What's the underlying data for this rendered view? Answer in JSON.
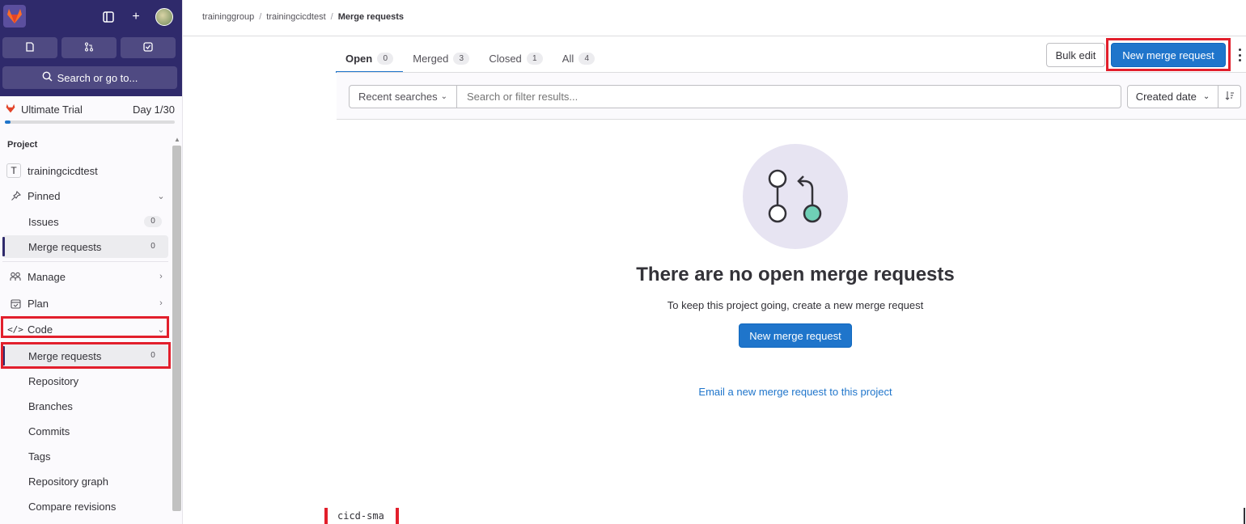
{
  "sidebar": {
    "search_label": "Search or go to...",
    "trial": {
      "label": "Ultimate Trial",
      "day": "Day 1/30",
      "progress": 0.033
    },
    "section_title": "Project",
    "project_name": "trainingcicdtest",
    "project_initial": "T",
    "pinned_label": "Pinned",
    "pinned_items": [
      {
        "label": "Issues",
        "count": "0"
      },
      {
        "label": "Merge requests",
        "count": "0"
      }
    ],
    "groups": [
      {
        "label": "Manage"
      },
      {
        "label": "Plan"
      },
      {
        "label": "Code"
      }
    ],
    "code_items": [
      {
        "label": "Merge requests",
        "count": "0"
      },
      {
        "label": "Repository"
      },
      {
        "label": "Branches"
      },
      {
        "label": "Commits"
      },
      {
        "label": "Tags"
      },
      {
        "label": "Repository graph"
      },
      {
        "label": "Compare revisions"
      }
    ]
  },
  "breadcrumb": [
    "traininggroup",
    "trainingcicdtest",
    "Merge requests"
  ],
  "tabs": [
    {
      "label": "Open",
      "count": "0"
    },
    {
      "label": "Merged",
      "count": "3"
    },
    {
      "label": "Closed",
      "count": "1"
    },
    {
      "label": "All",
      "count": "4"
    }
  ],
  "actions": {
    "bulk_edit": "Bulk edit",
    "new_mr": "New merge request"
  },
  "filter": {
    "recent_searches": "Recent searches",
    "search_placeholder": "Search or filter results...",
    "sort_label": "Created date"
  },
  "empty_state": {
    "title": "There are no open merge requests",
    "description": "To keep this project going, create a new merge request",
    "button": "New merge request",
    "email_link": "Email a new merge request to this project"
  },
  "bottom_tag": "cicd-sma",
  "colors": {
    "brand_dark": "#2f2a6b",
    "primary": "#1f75cb",
    "highlight": "#e21f2c",
    "mr_green": "#6fcfb6"
  }
}
